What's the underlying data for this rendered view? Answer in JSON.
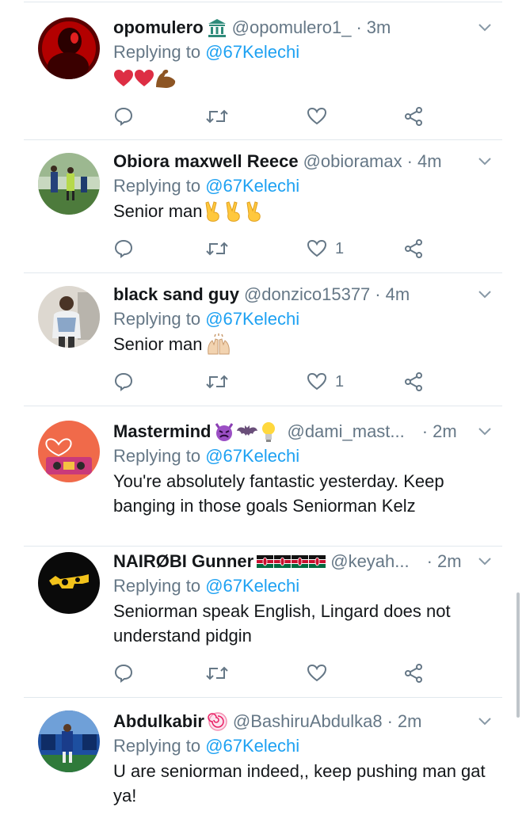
{
  "tweets": [
    {
      "name": "opomulero",
      "handle": "@opomulero1_",
      "separator": "·",
      "time": "3m",
      "replying_prefix": "Replying to ",
      "replying_to": "@67Kelechi",
      "text": "",
      "emojis_after_name": [
        "classical-building"
      ],
      "body_emojis": [
        "red-heart",
        "red-heart",
        "flexed-biceps"
      ],
      "likes": ""
    },
    {
      "name": "Obiora maxwell Reece",
      "handle": "@obioramax",
      "separator": "·",
      "time": "4m",
      "replying_prefix": "Replying to ",
      "replying_to": "@67Kelechi",
      "text": "Senior man",
      "emojis_after_name": [],
      "body_emojis": [
        "victory-hand",
        "victory-hand",
        "victory-hand"
      ],
      "likes": "1"
    },
    {
      "name": "black sand guy",
      "handle": "@donzico15377",
      "separator": "·",
      "time": "4m",
      "replying_prefix": "Replying to ",
      "replying_to": "@67Kelechi",
      "text": "Senior man",
      "emojis_after_name": [],
      "body_emojis": [
        "raising-hands"
      ],
      "likes": "1"
    },
    {
      "name": "Mastermind",
      "handle": "@dami_mast...",
      "separator": "·",
      "time": "2m",
      "replying_prefix": "Replying to ",
      "replying_to": "@67Kelechi",
      "text": "You're absolutely fantastic yesterday. Keep banging in those goals Seniorman Kelz",
      "emojis_after_name": [
        "angry-devil",
        "bat",
        "light-bulb"
      ],
      "body_emojis": [],
      "likes": ""
    },
    {
      "name": "NAIRØBI Gunner",
      "handle": "@keyah...",
      "separator": "·",
      "time": "2m",
      "replying_prefix": "Replying to ",
      "replying_to": "@67Kelechi",
      "text": "Seniorman speak English, Lingard does not understand pidgin",
      "emojis_after_name": [
        "kenya-flag",
        "kenya-flag",
        "kenya-flag",
        "kenya-flag"
      ],
      "body_emojis": [],
      "likes": ""
    },
    {
      "name": "Abdulkabir",
      "handle": "@BashiruAbdulka8",
      "separator": "·",
      "time": "2m",
      "replying_prefix": "Replying to ",
      "replying_to": "@67Kelechi",
      "text": "U are seniorman indeed,, keep pushing man gat ya!",
      "emojis_after_name": [
        "lollipop"
      ],
      "body_emojis": [],
      "likes": ""
    }
  ],
  "colors": {
    "text": "#14171a",
    "secondary": "#657786",
    "link": "#1da1f2",
    "divider": "#e1e8ed"
  },
  "icons": {
    "reply": "reply-icon",
    "retweet": "retweet-icon",
    "like": "like-icon",
    "share": "share-icon",
    "menu": "chevron-down-icon"
  }
}
